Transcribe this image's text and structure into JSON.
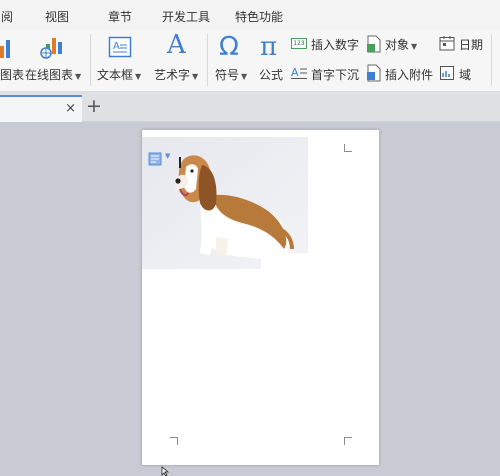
{
  "menu": {
    "tabs": [
      "阅",
      "视图",
      "章节",
      "开发工具",
      "特色功能"
    ]
  },
  "ribbon": {
    "chart_label": "图表",
    "online_chart_label": "在线图表",
    "textbox_label": "文本框",
    "wordart_label": "艺术字",
    "symbol_label": "符号",
    "formula_label": "公式",
    "insert_number_label": "插入数字",
    "object_label": "对象",
    "date_label": "日期",
    "dropcap_label": "首字下沉",
    "attachment_label": "插入附件",
    "field_label": "域",
    "number_icon_text": "123",
    "symbol_glyph": "Ω",
    "formula_glyph": "π",
    "wordart_glyph": "A"
  },
  "tabs": {
    "close_glyph": "×",
    "new_glyph": "+"
  },
  "colors": {
    "accent": "#3d7fd3",
    "ribbon_bg": "#f6f6f6",
    "canvas_bg": "#c8cbd3"
  }
}
